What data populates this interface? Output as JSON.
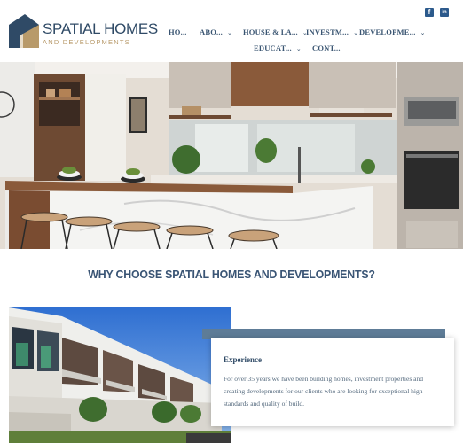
{
  "brand": {
    "name": "SPATIAL HOMES",
    "tagline": "AND DEVELOPMENTS",
    "colors": {
      "navy": "#2f4a66",
      "gold": "#b89a6a",
      "accent_band": "#5e7c97"
    }
  },
  "social": [
    {
      "name": "facebook-icon",
      "glyph": "f"
    },
    {
      "name": "linkedin-icon",
      "glyph": "in"
    }
  ],
  "nav": {
    "items": [
      {
        "label": "HO...",
        "has_dropdown": false
      },
      {
        "label": "ABO...",
        "has_dropdown": true
      },
      {
        "label": "HOUSE & LA...",
        "has_dropdown": true
      },
      {
        "label": "INVESTM...",
        "has_dropdown": true
      },
      {
        "label": "DEVELOPME...",
        "has_dropdown": true
      },
      {
        "label": "EDUCAT...",
        "has_dropdown": true
      },
      {
        "label": "CONT...",
        "has_dropdown": false
      }
    ],
    "dropdown_icon": "chevron-down-icon"
  },
  "hero": {
    "image": "modern-kitchen-photo"
  },
  "section": {
    "title": "WHY CHOOSE SPATIAL HOMES AND DEVELOPMENTS?"
  },
  "feature": {
    "image": "townhouses-photo",
    "card": {
      "title": "Experience",
      "body": "For over 35 years we have been building homes, investment properties and creating developments for our clients who are looking for exceptional high standards and quality of build."
    }
  }
}
